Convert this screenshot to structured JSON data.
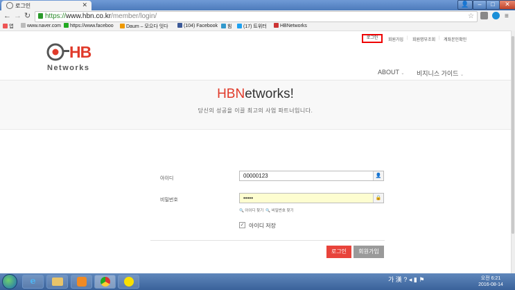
{
  "browser": {
    "tab_title": "로그인",
    "url_green": "https://",
    "url_host": "www.hbn.co.kr",
    "url_path": "/member/login/",
    "bookmarks": [
      {
        "label": "앱",
        "color": "#e55"
      },
      {
        "label": "www.naver.com",
        "color": "#bbb"
      },
      {
        "label": "https://www.faceboo",
        "color": "#2a2"
      },
      {
        "label": "Daum – 모으다 잇다",
        "color": "#e90"
      },
      {
        "label": "(104) Facebook",
        "color": "#3b5998"
      },
      {
        "label": "힘",
        "color": "#39c"
      },
      {
        "label": "(17) 트위터",
        "color": "#1da1f2"
      },
      {
        "label": "HBNetworks",
        "color": "#c33"
      }
    ]
  },
  "site": {
    "logo_text": "Networks",
    "logo_letters": "HB",
    "top_links": {
      "login": "로그인",
      "join": "회원가입",
      "find": "회원명부조회",
      "verify": "계좌본인확인"
    },
    "nav": {
      "about": "ABOUT",
      "business": "비지니스 가이드"
    },
    "hero": {
      "title_red": "HBN",
      "title_rest": "etworks!",
      "subtitle": "당신의 성공을 이끌 최고의 사업 파트너입니다."
    },
    "form": {
      "id_label": "아이디",
      "id_value": "00000123",
      "pw_label": "비밀번호",
      "pw_value": "•••••",
      "find_id": "아이디 찾기",
      "find_pw": "비밀번호 찾기",
      "remember_label": "아이디 저장",
      "remember_checked": true,
      "login_button": "로그인",
      "join_button": "회원가입"
    }
  },
  "taskbar": {
    "tray_lang": "가",
    "tray_hanja": "漢",
    "clock_ampm": "오전 6:21",
    "clock_date": "2016-08-14"
  },
  "colors": {
    "brand_red": "#e03a2a",
    "button_red": "#e8433b",
    "button_gray": "#9a9a9a"
  }
}
